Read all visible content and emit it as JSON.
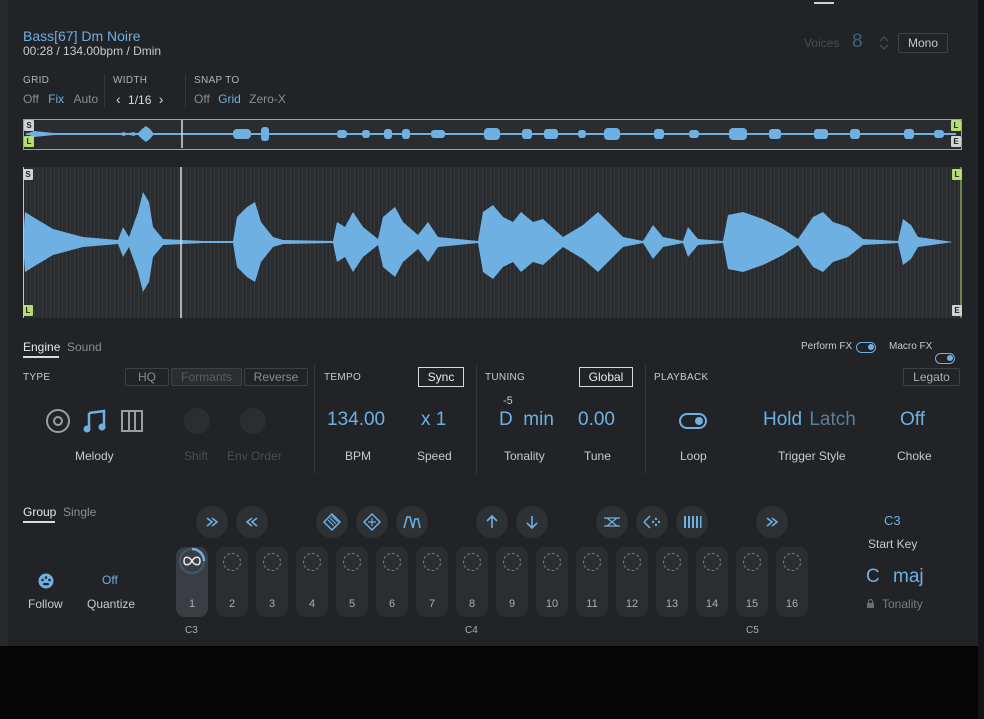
{
  "header": {
    "sample_name": "Bass[67] Dm Noire",
    "sample_info": "00:28 / 134.00bpm / Dmin",
    "voices_label": "Voices",
    "voices_value": "8",
    "mono_label": "Mono"
  },
  "grid": {
    "label": "GRID",
    "options": [
      "Off",
      "Fix",
      "Auto"
    ],
    "selected": "Fix"
  },
  "width": {
    "label": "WIDTH",
    "value": "1/16"
  },
  "snap": {
    "label": "SNAP TO",
    "options": [
      "Off",
      "Grid",
      "Zero-X"
    ],
    "selected": "Grid"
  },
  "markers": {
    "start": "S",
    "loop": "L",
    "end": "E"
  },
  "tabs": {
    "engine": "Engine",
    "sound": "Sound",
    "perform_fx": "Perform FX",
    "macro_fx": "Macro FX"
  },
  "type": {
    "label": "TYPE",
    "hq": "HQ",
    "formants": "Formants",
    "reverse": "Reverse",
    "mode_label": "Melody",
    "shift_label": "Shift",
    "env_order_label": "Env Order"
  },
  "tempo": {
    "label": "TEMPO",
    "sync": "Sync",
    "bpm_value": "134.00",
    "bpm_label": "BPM",
    "speed_value": "x 1",
    "speed_label": "Speed"
  },
  "tuning": {
    "label": "TUNING",
    "global": "Global",
    "offset": "-5",
    "tonality_value": "D  min",
    "tonality_label": "Tonality",
    "tune_value": "0.00",
    "tune_label": "Tune"
  },
  "playback": {
    "label": "PLAYBACK",
    "legato": "Legato",
    "loop_label": "Loop",
    "trigger_hold": "Hold",
    "trigger_latch": "Latch",
    "trigger_label": "Trigger Style",
    "choke_value": "Off",
    "choke_label": "Choke"
  },
  "group": {
    "group_tab": "Group",
    "single_tab": "Single",
    "follow_label": "Follow",
    "quantize_value": "Off",
    "quantize_label": "Quantize"
  },
  "pads": [
    "1",
    "2",
    "3",
    "4",
    "5",
    "6",
    "7",
    "8",
    "9",
    "10",
    "11",
    "12",
    "13",
    "14",
    "15",
    "16"
  ],
  "octave_labels": [
    "C3",
    "C4",
    "C5"
  ],
  "key": {
    "start_key_value": "C3",
    "start_key_label": "Start Key",
    "tonality_root": "C",
    "tonality_scale": "maj",
    "tonality_label": "Tonality"
  },
  "colors": {
    "accent": "#6fb0e2",
    "background": "#212326",
    "loop_marker": "#b6dd6f"
  }
}
